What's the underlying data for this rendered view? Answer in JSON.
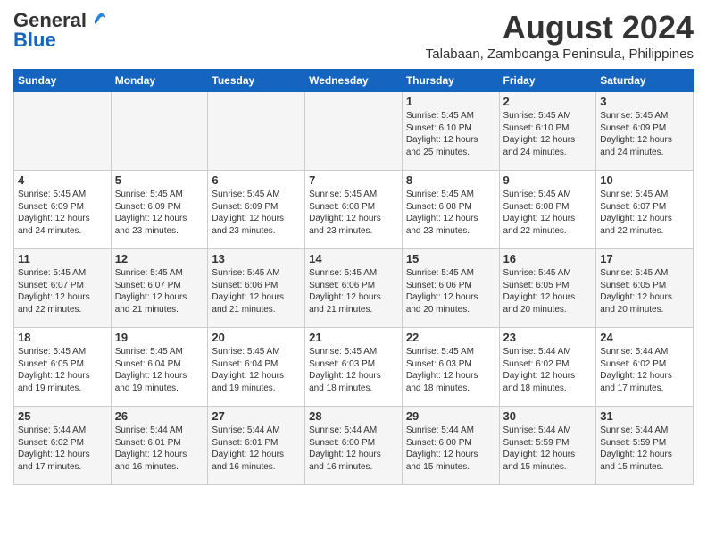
{
  "header": {
    "logo_general": "General",
    "logo_blue": "Blue",
    "month_year": "August 2024",
    "location": "Talabaan, Zamboanga Peninsula, Philippines"
  },
  "days_of_week": [
    "Sunday",
    "Monday",
    "Tuesday",
    "Wednesday",
    "Thursday",
    "Friday",
    "Saturday"
  ],
  "weeks": [
    [
      {
        "day": "",
        "info": ""
      },
      {
        "day": "",
        "info": ""
      },
      {
        "day": "",
        "info": ""
      },
      {
        "day": "",
        "info": ""
      },
      {
        "day": "1",
        "info": "Sunrise: 5:45 AM\nSunset: 6:10 PM\nDaylight: 12 hours\nand 25 minutes."
      },
      {
        "day": "2",
        "info": "Sunrise: 5:45 AM\nSunset: 6:10 PM\nDaylight: 12 hours\nand 24 minutes."
      },
      {
        "day": "3",
        "info": "Sunrise: 5:45 AM\nSunset: 6:09 PM\nDaylight: 12 hours\nand 24 minutes."
      }
    ],
    [
      {
        "day": "4",
        "info": "Sunrise: 5:45 AM\nSunset: 6:09 PM\nDaylight: 12 hours\nand 24 minutes."
      },
      {
        "day": "5",
        "info": "Sunrise: 5:45 AM\nSunset: 6:09 PM\nDaylight: 12 hours\nand 23 minutes."
      },
      {
        "day": "6",
        "info": "Sunrise: 5:45 AM\nSunset: 6:09 PM\nDaylight: 12 hours\nand 23 minutes."
      },
      {
        "day": "7",
        "info": "Sunrise: 5:45 AM\nSunset: 6:08 PM\nDaylight: 12 hours\nand 23 minutes."
      },
      {
        "day": "8",
        "info": "Sunrise: 5:45 AM\nSunset: 6:08 PM\nDaylight: 12 hours\nand 23 minutes."
      },
      {
        "day": "9",
        "info": "Sunrise: 5:45 AM\nSunset: 6:08 PM\nDaylight: 12 hours\nand 22 minutes."
      },
      {
        "day": "10",
        "info": "Sunrise: 5:45 AM\nSunset: 6:07 PM\nDaylight: 12 hours\nand 22 minutes."
      }
    ],
    [
      {
        "day": "11",
        "info": "Sunrise: 5:45 AM\nSunset: 6:07 PM\nDaylight: 12 hours\nand 22 minutes."
      },
      {
        "day": "12",
        "info": "Sunrise: 5:45 AM\nSunset: 6:07 PM\nDaylight: 12 hours\nand 21 minutes."
      },
      {
        "day": "13",
        "info": "Sunrise: 5:45 AM\nSunset: 6:06 PM\nDaylight: 12 hours\nand 21 minutes."
      },
      {
        "day": "14",
        "info": "Sunrise: 5:45 AM\nSunset: 6:06 PM\nDaylight: 12 hours\nand 21 minutes."
      },
      {
        "day": "15",
        "info": "Sunrise: 5:45 AM\nSunset: 6:06 PM\nDaylight: 12 hours\nand 20 minutes."
      },
      {
        "day": "16",
        "info": "Sunrise: 5:45 AM\nSunset: 6:05 PM\nDaylight: 12 hours\nand 20 minutes."
      },
      {
        "day": "17",
        "info": "Sunrise: 5:45 AM\nSunset: 6:05 PM\nDaylight: 12 hours\nand 20 minutes."
      }
    ],
    [
      {
        "day": "18",
        "info": "Sunrise: 5:45 AM\nSunset: 6:05 PM\nDaylight: 12 hours\nand 19 minutes."
      },
      {
        "day": "19",
        "info": "Sunrise: 5:45 AM\nSunset: 6:04 PM\nDaylight: 12 hours\nand 19 minutes."
      },
      {
        "day": "20",
        "info": "Sunrise: 5:45 AM\nSunset: 6:04 PM\nDaylight: 12 hours\nand 19 minutes."
      },
      {
        "day": "21",
        "info": "Sunrise: 5:45 AM\nSunset: 6:03 PM\nDaylight: 12 hours\nand 18 minutes."
      },
      {
        "day": "22",
        "info": "Sunrise: 5:45 AM\nSunset: 6:03 PM\nDaylight: 12 hours\nand 18 minutes."
      },
      {
        "day": "23",
        "info": "Sunrise: 5:44 AM\nSunset: 6:02 PM\nDaylight: 12 hours\nand 18 minutes."
      },
      {
        "day": "24",
        "info": "Sunrise: 5:44 AM\nSunset: 6:02 PM\nDaylight: 12 hours\nand 17 minutes."
      }
    ],
    [
      {
        "day": "25",
        "info": "Sunrise: 5:44 AM\nSunset: 6:02 PM\nDaylight: 12 hours\nand 17 minutes."
      },
      {
        "day": "26",
        "info": "Sunrise: 5:44 AM\nSunset: 6:01 PM\nDaylight: 12 hours\nand 16 minutes."
      },
      {
        "day": "27",
        "info": "Sunrise: 5:44 AM\nSunset: 6:01 PM\nDaylight: 12 hours\nand 16 minutes."
      },
      {
        "day": "28",
        "info": "Sunrise: 5:44 AM\nSunset: 6:00 PM\nDaylight: 12 hours\nand 16 minutes."
      },
      {
        "day": "29",
        "info": "Sunrise: 5:44 AM\nSunset: 6:00 PM\nDaylight: 12 hours\nand 15 minutes."
      },
      {
        "day": "30",
        "info": "Sunrise: 5:44 AM\nSunset: 5:59 PM\nDaylight: 12 hours\nand 15 minutes."
      },
      {
        "day": "31",
        "info": "Sunrise: 5:44 AM\nSunset: 5:59 PM\nDaylight: 12 hours\nand 15 minutes."
      }
    ]
  ]
}
